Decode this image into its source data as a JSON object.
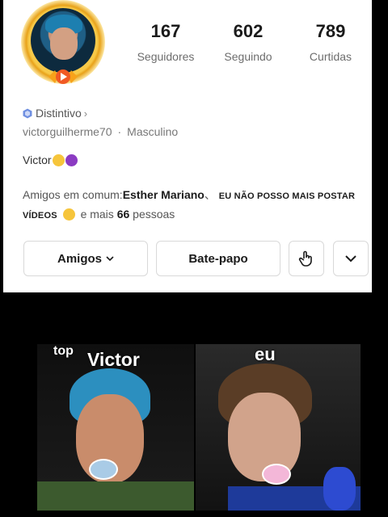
{
  "profile": {
    "stats": [
      {
        "value": "167",
        "label": "Seguidores"
      },
      {
        "value": "602",
        "label": "Seguindo"
      },
      {
        "value": "789",
        "label": "Curtidas"
      }
    ],
    "badge_label": "Distintivo",
    "username": "victorguilherme70",
    "gender": "Masculino",
    "bio": "Victor",
    "mutual": {
      "prefix": "Amigos em comum:",
      "friend1": "Esther Mariano",
      "separator": "、",
      "friend2": "EU NÃO POSSO MAIS POSTAR VÍDEOS",
      "middle": "e mais",
      "count": "66",
      "suffix": "pessoas"
    }
  },
  "buttons": {
    "friends": "Amigos",
    "chat": "Bate-papo"
  },
  "icons": {
    "badge": "hexagon-badge-icon",
    "chevron_right": "chevron-right-icon",
    "chevron_down": "chevron-down-icon",
    "share": "hand-share-icon",
    "more": "chevron-down-icon"
  },
  "meme": {
    "caption_top": "top",
    "caption_left": "Victor",
    "caption_right": "eu"
  },
  "colors": {
    "card_bg": "#ffffff",
    "page_bg": "#000000",
    "text_primary": "#1b1b1b",
    "text_secondary": "#6d6d6d"
  }
}
